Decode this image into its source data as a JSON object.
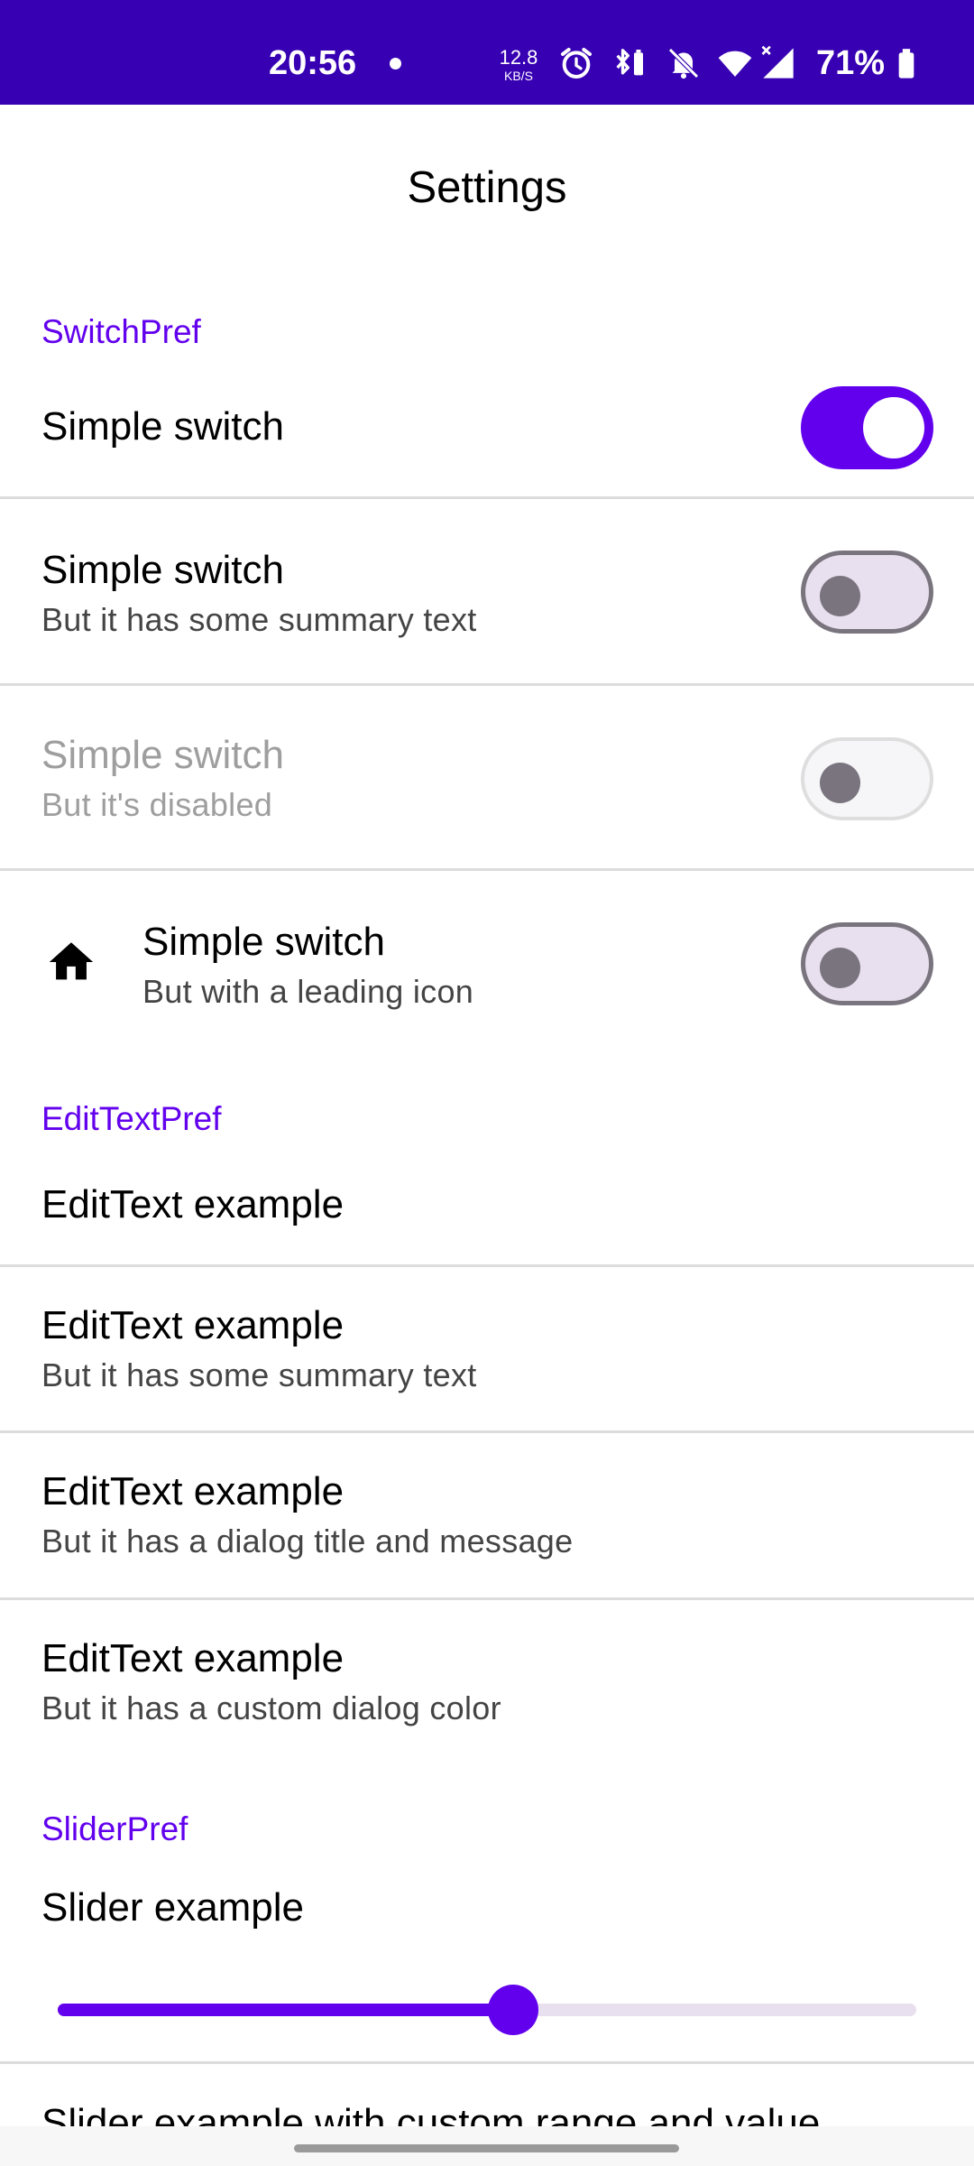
{
  "status_bar": {
    "time": "20:56",
    "net_speed_value": "12.8",
    "net_speed_unit": "KB/S",
    "battery_percent": "71%",
    "icons": [
      "dot-icon",
      "alarm-icon",
      "bluetooth-battery-icon",
      "bell-off-icon",
      "wifi-icon",
      "signal-icon",
      "battery-icon"
    ]
  },
  "header": {
    "title": "Settings"
  },
  "sections": {
    "switch_pref": {
      "label": "SwitchPref",
      "items": [
        {
          "title": "Simple switch",
          "summary": "",
          "checked": true,
          "enabled": true
        },
        {
          "title": "Simple switch",
          "summary": "But it has some summary text",
          "checked": false,
          "enabled": true
        },
        {
          "title": "Simple switch",
          "summary": "But it's disabled",
          "checked": false,
          "enabled": false
        },
        {
          "title": "Simple switch",
          "summary": "But with a leading icon",
          "checked": false,
          "enabled": true,
          "icon": "home-icon"
        }
      ]
    },
    "edit_text_pref": {
      "label": "EditTextPref",
      "items": [
        {
          "title": "EditText example",
          "summary": ""
        },
        {
          "title": "EditText example",
          "summary": "But it has some summary text"
        },
        {
          "title": "EditText example",
          "summary": "But it has a dialog title and message"
        },
        {
          "title": "EditText example",
          "summary": "But it has a custom dialog color"
        }
      ]
    },
    "slider_pref": {
      "label": "SliderPref",
      "items": [
        {
          "title": "Slider example",
          "value_fraction": 0.53
        },
        {
          "title": "Slider example with custom range and value"
        }
      ]
    }
  },
  "colors": {
    "status_bar": "#3700b3",
    "accent": "#6200ee",
    "switch_off_track": "#e8e0ee",
    "switch_off_outline": "#79747e"
  }
}
